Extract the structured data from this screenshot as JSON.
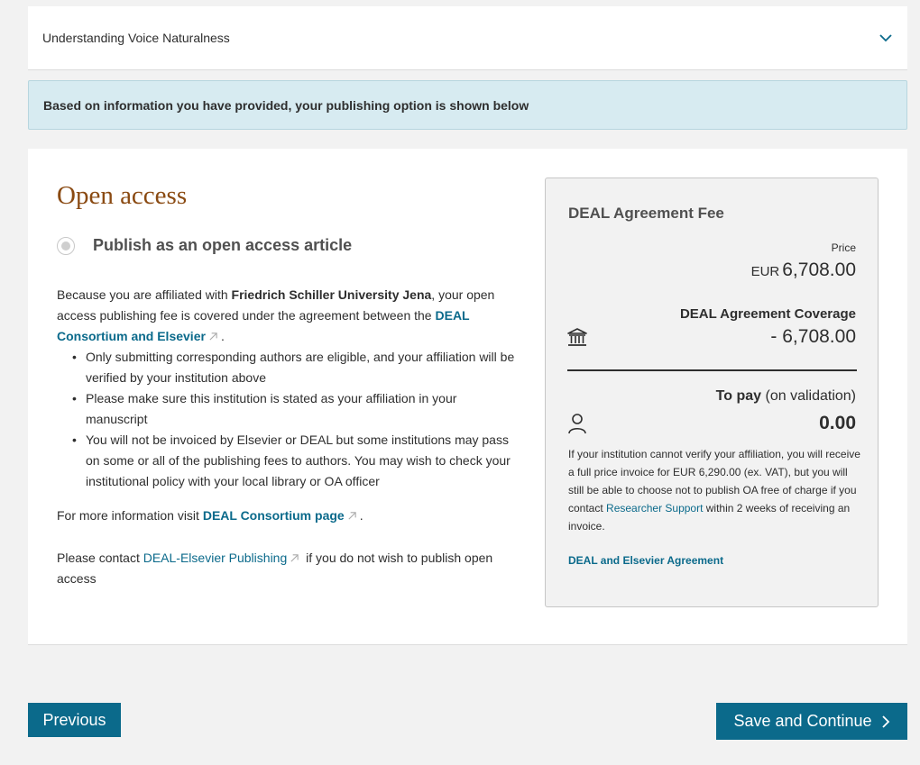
{
  "accordion": {
    "title": "Understanding Voice Naturalness",
    "icon": "chevron-down-icon"
  },
  "banner": {
    "text": "Based on information you have provided, your publishing option is shown below"
  },
  "open_access": {
    "title": "Open access",
    "radio_label": "Publish as an open access article",
    "intro_prefix": "Because you are affiliated with ",
    "institution": "Friedrich Schiller University Jena",
    "intro_middle": ", your open access publishing fee is covered under the agreement between the ",
    "consortium_link": "DEAL Consortium and Elsevier",
    "intro_suffix": ".",
    "bullets": [
      "Only submitting corresponding authors are eligible, and your affiliation will be verified by your institution above",
      "Please make sure this institution is stated as your affiliation in your manuscript",
      "You will not be invoiced by Elsevier or DEAL but some institutions may pass on some or all of the publishing fees to authors. You may wish to check your institutional policy with your local library or OA officer"
    ],
    "more_info_prefix": "For more information visit ",
    "more_info_link": "DEAL Consortium page",
    "more_info_suffix": ".",
    "contact_prefix": "Please contact ",
    "contact_link": "DEAL-Elsevier Publishing",
    "contact_suffix": " if you do not wish to publish open access"
  },
  "fee": {
    "title": "DEAL Agreement Fee",
    "price_label": "Price",
    "currency": "EUR",
    "price_value": "6,708.00",
    "coverage_label": "DEAL Agreement Coverage",
    "coverage_value": "- 6,708.00",
    "topay_label": "To pay",
    "topay_qualifier": " (on validation)",
    "topay_value": "0.00",
    "note_prefix": "If your institution cannot verify your affiliation, you will receive a full price invoice for EUR 6,290.00 (ex. VAT), but you will still be able to choose not to publish OA free of charge if you contact ",
    "note_link": "Researcher Support",
    "note_suffix": " within 2 weeks of receiving an invoice.",
    "agreement_link": "DEAL and Elsevier Agreement"
  },
  "buttons": {
    "previous": "Previous",
    "save_continue": "Save and Continue"
  },
  "colors": {
    "primary": "#0b6a8b",
    "title_brown": "#8a4a12",
    "banner_bg": "#d7ebf1"
  }
}
